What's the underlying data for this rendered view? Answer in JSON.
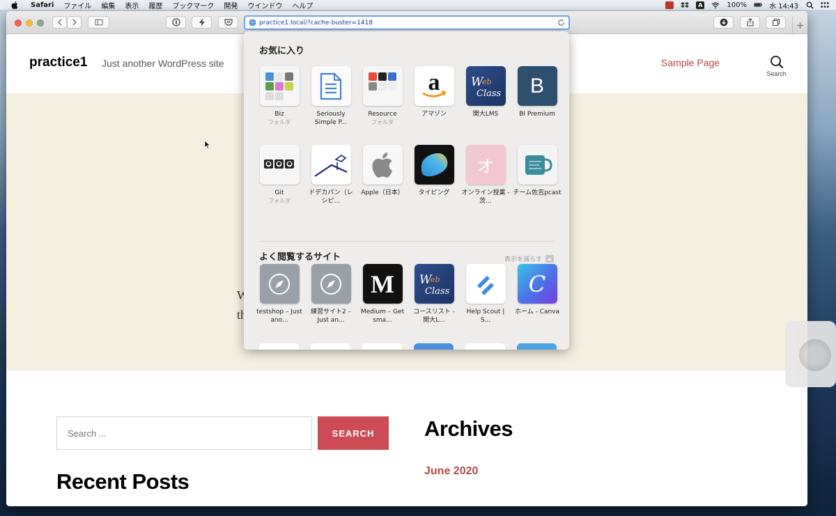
{
  "menubar": {
    "app_name": "Safari",
    "items": [
      "ファイル",
      "編集",
      "表示",
      "履歴",
      "ブックマーク",
      "開発",
      "ウインドウ",
      "ヘルプ"
    ],
    "battery": "100%",
    "clock": "水 14:43",
    "input_indicator": "A"
  },
  "browser": {
    "url": "practice1.local/?cache-buster=1418"
  },
  "site": {
    "title": "practice1",
    "description": "Just another WordPress site",
    "nav_link": "Sample Page",
    "search_label": "Search",
    "hero_peek_1": "W",
    "hero_peek_2": "th"
  },
  "footer": {
    "search_placeholder": "Search ...",
    "search_button": "SEARCH",
    "recent_posts": "Recent Posts",
    "archives": "Archives",
    "archive_link": "June 2020"
  },
  "favorites": {
    "heading": "お気に入り",
    "items": [
      {
        "label": "Biz",
        "sub": "フォルダ",
        "icon": "folder-grid-icon"
      },
      {
        "label": "Seriously Simple P...",
        "sub": "",
        "icon": "document-icon"
      },
      {
        "label": "Resource",
        "sub": "フォルダ",
        "icon": "folder-grid-icon"
      },
      {
        "label": "アマゾン",
        "sub": "",
        "icon": "amazon-icon"
      },
      {
        "label": "関大LMS",
        "sub": "",
        "icon": "webclass-icon"
      },
      {
        "label": "BI Premium",
        "sub": "",
        "icon": "letter-b-icon",
        "letter": "B"
      },
      {
        "label": "Git",
        "sub": "フォルダ",
        "icon": "github-folder-icon"
      },
      {
        "label": "ドデカパン（レシピ…",
        "sub": "",
        "icon": "sketch-icon"
      },
      {
        "label": "Apple（日本）",
        "sub": "",
        "icon": "apple-icon"
      },
      {
        "label": "タイピング",
        "sub": "",
        "icon": "blob-icon"
      },
      {
        "label": "オンライン授業 - 茨…",
        "sub": "",
        "icon": "letter-o-icon",
        "letter": "オ"
      },
      {
        "label": "チーム佐吉pcast",
        "sub": "",
        "icon": "mug-icon"
      }
    ]
  },
  "frequent": {
    "heading": "よく閲覧するサイト",
    "show_less": "表示を減らす",
    "items": [
      {
        "label": "testshop – Just ano...",
        "icon": "compass-icon"
      },
      {
        "label": "練習サイト2 – Just an...",
        "icon": "compass-icon"
      },
      {
        "label": "Medium – Get sma...",
        "icon": "medium-icon",
        "letter": "M"
      },
      {
        "label": "コースリスト - 関大L...",
        "icon": "webclass-icon"
      },
      {
        "label": "Help Scout | S...",
        "icon": "helpscout-icon"
      },
      {
        "label": "ホーム - Canva",
        "icon": "canva-icon",
        "letter": "C"
      }
    ]
  },
  "colors": {
    "accent": "#cc4b55",
    "link": "#b04a46",
    "hero_bg": "#f5efe0",
    "url_focus": "#6aa7e8"
  }
}
